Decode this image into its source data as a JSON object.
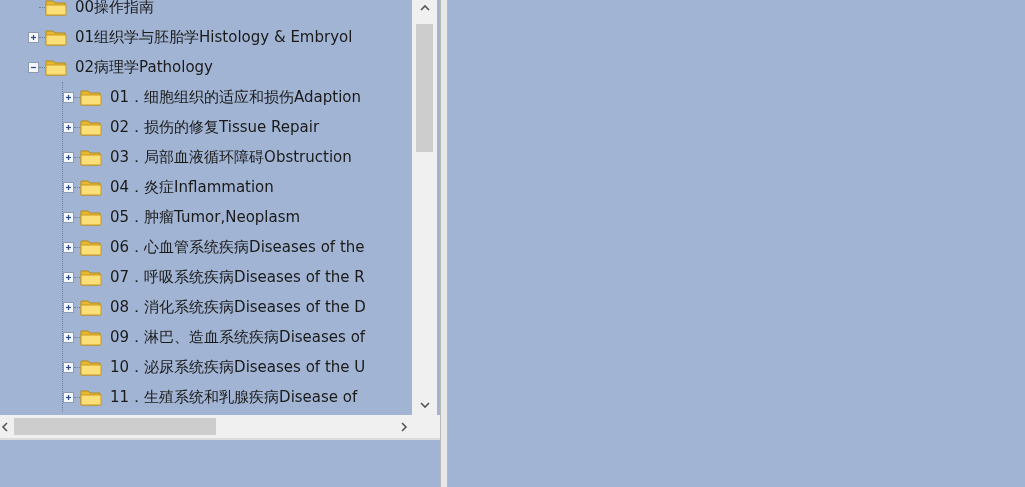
{
  "tree": {
    "items": [
      {
        "label": "00操作指南",
        "kind": "leaf"
      },
      {
        "label": "01组织学与胚胎学Histology & Embryol",
        "kind": "folder",
        "expanded": false
      },
      {
        "label": "02病理学Pathology",
        "kind": "folder",
        "expanded": true,
        "children": [
          {
            "label": "01．细胞组织的适应和损伤Adaption",
            "kind": "folder",
            "expanded": false
          },
          {
            "label": "02．损伤的修复Tissue Repair",
            "kind": "folder",
            "expanded": false
          },
          {
            "label": "03．局部血液循环障碍Obstruction",
            "kind": "folder",
            "expanded": false
          },
          {
            "label": "04．炎症Inflammation",
            "kind": "folder",
            "expanded": false
          },
          {
            "label": "05．肿瘤Tumor,Neoplasm",
            "kind": "folder",
            "expanded": false
          },
          {
            "label": "06．心血管系统疾病Diseases of the",
            "kind": "folder",
            "expanded": false
          },
          {
            "label": "07．呼吸系统疾病Diseases of the R",
            "kind": "folder",
            "expanded": false
          },
          {
            "label": "08．消化系统疾病Diseases of the D",
            "kind": "folder",
            "expanded": false
          },
          {
            "label": "09．淋巴、造血系统疾病Diseases of",
            "kind": "folder",
            "expanded": false
          },
          {
            "label": "10．泌尿系统疾病Diseases of the U",
            "kind": "folder",
            "expanded": false
          },
          {
            "label": "11．生殖系统和乳腺疾病Disease of",
            "kind": "folder",
            "expanded": false
          }
        ]
      }
    ]
  }
}
